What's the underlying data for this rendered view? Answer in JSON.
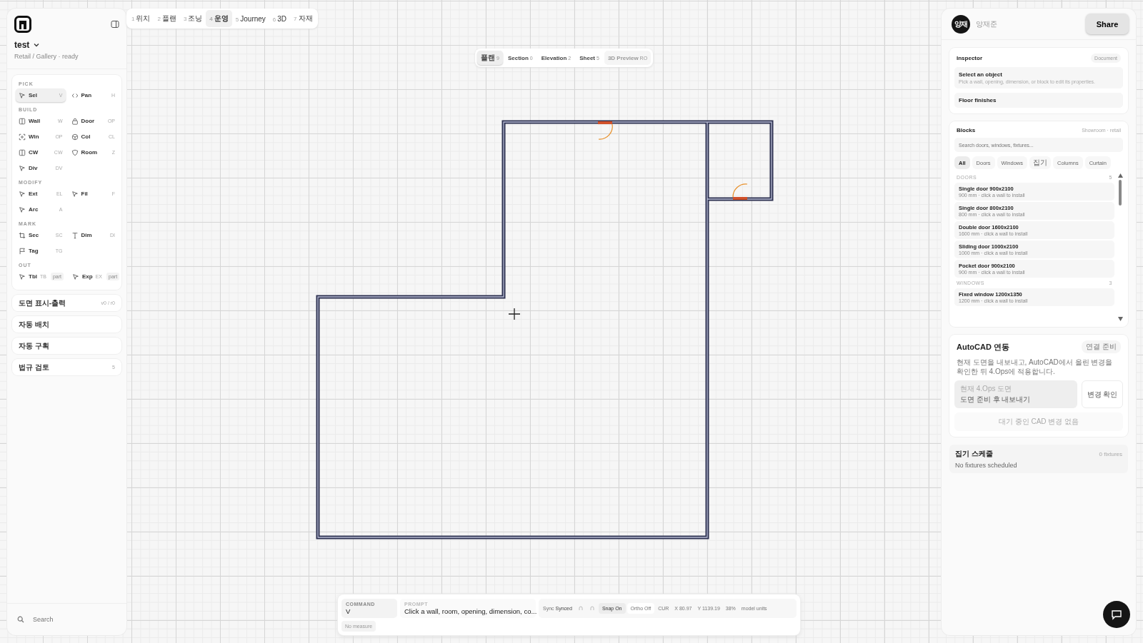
{
  "project": {
    "name": "test",
    "subtitle": "Retail / Gallery · ready"
  },
  "sidebar": {
    "sections": [
      {
        "title": "PICK",
        "tools": [
          {
            "label": "Sel",
            "key": "V",
            "selected": true
          },
          {
            "label": "Pan",
            "key": "H",
            "selected": false
          }
        ]
      },
      {
        "title": "BUILD",
        "tools": [
          {
            "label": "Wall",
            "key": "W",
            "selected": false
          },
          {
            "label": "Door",
            "key": "OP",
            "selected": false
          },
          {
            "label": "Win",
            "key": "OP",
            "selected": false
          },
          {
            "label": "Col",
            "key": "CL",
            "selected": false
          },
          {
            "label": "CW",
            "key": "CW",
            "selected": false
          },
          {
            "label": "Room",
            "key": "Z",
            "selected": false
          },
          {
            "label": "Div",
            "key": "DV",
            "selected": false
          }
        ]
      },
      {
        "title": "MODIFY",
        "tools": [
          {
            "label": "Ext",
            "key": "EL",
            "selected": false
          },
          {
            "label": "Fil",
            "key": "F",
            "selected": false
          },
          {
            "label": "Arc",
            "key": "A",
            "selected": false
          }
        ]
      },
      {
        "title": "MARK",
        "tools": [
          {
            "label": "Sec",
            "key": "SC",
            "selected": false
          },
          {
            "label": "Dim",
            "key": "DI",
            "selected": false
          },
          {
            "label": "Tag",
            "key": "TG",
            "selected": false
          }
        ]
      },
      {
        "title": "OUT",
        "tools": [
          {
            "label": "Tbl",
            "key": "TB",
            "badge": "part",
            "selected": false
          },
          {
            "label": "Exp",
            "key": "EX",
            "badge": "part",
            "selected": false
          }
        ]
      }
    ],
    "panels": [
      {
        "label": "도면 표시-출력",
        "meta": "v0 / r0"
      },
      {
        "label": "자동 배치"
      },
      {
        "label": "자동 구획"
      },
      {
        "label": "법규 검토",
        "meta": "5"
      }
    ],
    "search": {
      "placeholder": "Search"
    }
  },
  "stage_tabs": [
    {
      "num": "1",
      "label": "위치",
      "selected": false
    },
    {
      "num": "2",
      "label": "플랜",
      "selected": false
    },
    {
      "num": "3",
      "label": "조닝",
      "selected": false
    },
    {
      "num": "4",
      "label": "운영",
      "selected": true
    },
    {
      "num": "5",
      "label": "Journey",
      "selected": false
    },
    {
      "num": "6",
      "label": "3D",
      "selected": false
    },
    {
      "num": "7",
      "label": "자재",
      "selected": false
    }
  ],
  "view_tabs": [
    {
      "label": "플랜",
      "count": "9",
      "selected": true,
      "disabled": false
    },
    {
      "label": "Section",
      "count": "0",
      "selected": false,
      "disabled": false
    },
    {
      "label": "Elevation",
      "count": "2",
      "selected": false,
      "disabled": false
    },
    {
      "label": "Sheet",
      "count": "5",
      "selected": false,
      "disabled": false
    },
    {
      "label": "3D Preview",
      "count": "RO",
      "selected": false,
      "disabled": true
    }
  ],
  "command_bar": {
    "command_label": "COMMAND",
    "command": "V",
    "prompt_label": "PROMPT",
    "prompt": "Click a wall, room, opening, dimension, co...",
    "sync_label": "Sync",
    "sync": "Synced",
    "snap": "Snap On",
    "snap_on": true,
    "ortho": "Ortho Off",
    "ortho_on": false,
    "cur": "CUR",
    "x": "X 80.97",
    "y": "Y 1139.19",
    "zoom": "38%",
    "units": "model units",
    "measure": "No measure"
  },
  "user": {
    "initials": "양재",
    "name": "양재준",
    "share": "Share"
  },
  "inspector": {
    "title": "Inspector",
    "badge": "Document",
    "select_title": "Select an object",
    "select_desc": "Pick a wall, opening, dimension, or block to edit its properties.",
    "finishes": "Floor finishes"
  },
  "blocks": {
    "title": "Blocks",
    "meta": "Showroom · retail",
    "search_placeholder": "Search doors, windows, fixtures...",
    "filters": [
      {
        "label": "All",
        "selected": true
      },
      {
        "label": "Doors",
        "selected": false
      },
      {
        "label": "Windows",
        "selected": false
      },
      {
        "label": "집기",
        "selected": false
      },
      {
        "label": "Columns",
        "selected": false
      },
      {
        "label": "Curtain",
        "selected": false
      }
    ],
    "groups": [
      {
        "title": "DOORS",
        "count": "5",
        "items": [
          {
            "name": "Single door 900x2100",
            "desc": "900 mm · click a wall to install"
          },
          {
            "name": "Single door 800x2100",
            "desc": "800 mm · click a wall to install"
          },
          {
            "name": "Double door 1600x2100",
            "desc": "1600 mm · click a wall to install"
          },
          {
            "name": "Sliding door 1000x2100",
            "desc": "1000 mm · click a wall to install"
          },
          {
            "name": "Pocket door 900x2100",
            "desc": "900 mm · click a wall to install"
          }
        ]
      },
      {
        "title": "WINDOWS",
        "count": "3",
        "items": [
          {
            "name": "Fixed window 1200x1350",
            "desc": "1200 mm · click a wall to install"
          }
        ]
      }
    ]
  },
  "autocad": {
    "title": "AutoCAD 연동",
    "badge": "연결 준비",
    "desc": "현재 도면을 내보내고, AutoCAD에서 올린 변경을 확인한 뒤 4.Ops에 적용합니다.",
    "current_label": "현재 4.Ops 도면",
    "current_value": "도면 준비 후 내보내기",
    "button": "변경 확인",
    "empty": "대기 중인 CAD 변경 없음"
  },
  "schedule": {
    "title": "집기 스케줄",
    "count": "0 fixtures",
    "empty": "No fixtures scheduled"
  }
}
